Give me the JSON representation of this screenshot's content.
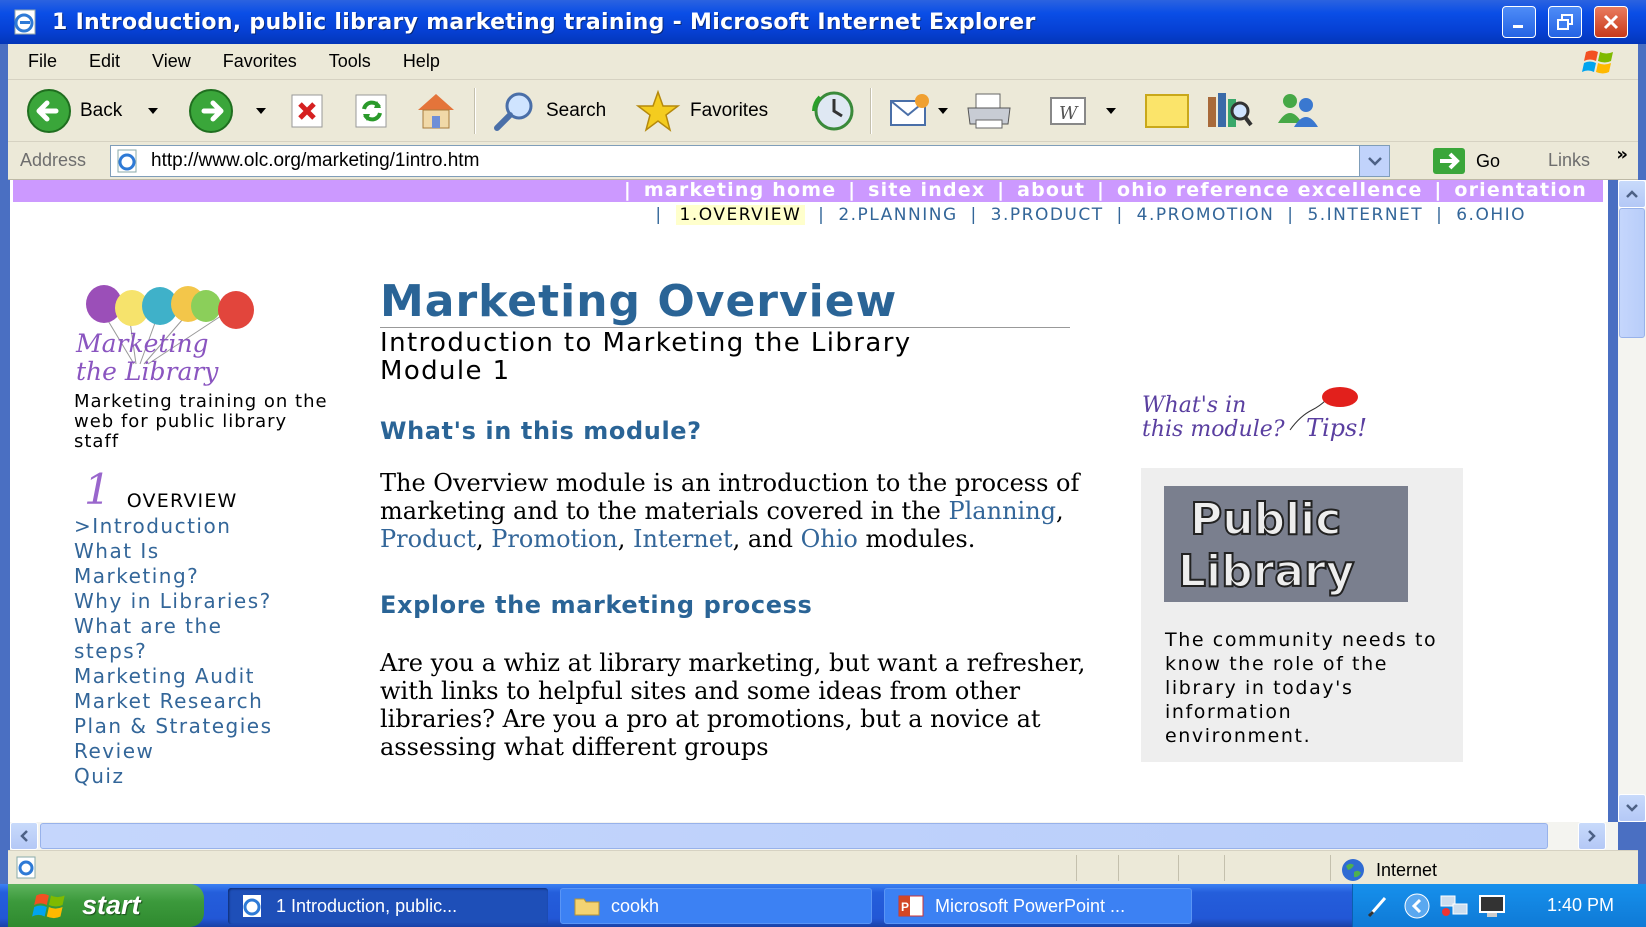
{
  "window": {
    "title": "1 Introduction, public library marketing training - Microsoft Internet Explorer"
  },
  "menubar": {
    "items": [
      "File",
      "Edit",
      "View",
      "Favorites",
      "Tools",
      "Help"
    ]
  },
  "toolbar": {
    "back_label": "Back",
    "search_label": "Search",
    "favorites_label": "Favorites"
  },
  "addressbar": {
    "label": "Address",
    "url": "http://www.olc.org/marketing/1intro.htm",
    "go_label": "Go",
    "links_label": "Links"
  },
  "site_nav": {
    "top_links": [
      "marketing home",
      "site index",
      "about",
      "ohio reference excellence",
      "orientation"
    ],
    "modules": [
      "1.OVERVIEW",
      "2.PLANNING",
      "3.PRODUCT",
      "4.PROMOTION",
      "5.INTERNET",
      "6.OHIO"
    ],
    "current_module": "1.OVERVIEW"
  },
  "left": {
    "logo_line1": "Marketing",
    "logo_line2": "the Library",
    "tagline": "Marketing training on the web for public library staff",
    "module_number": "1",
    "section": "OVERVIEW",
    "links": [
      "Introduction",
      "What Is Marketing?",
      "Why in Libraries?",
      "What are the steps?",
      "Marketing Audit",
      "Market Research",
      "Plan & Strategies",
      "Review",
      "Quiz"
    ],
    "current_link_prefix": ">"
  },
  "main": {
    "title": "Marketing Overview",
    "subtitle_line1": "Introduction to Marketing the Library",
    "subtitle_line2": "Module 1",
    "heading1": "What's in this module?",
    "para1_pre": "The Overview module is an introduction to the process of marketing and to the materials covered in the ",
    "para1_links": [
      "Planning",
      "Product",
      "Promotion",
      "Internet",
      "Ohio"
    ],
    "para1_sep": ", ",
    "para1_and": ", and ",
    "para1_post": " modules.",
    "heading2": "Explore the marketing process",
    "para2": "Are you a whiz at library marketing, but want a refresher, with links to helpful sites and some ideas from other libraries? Are you a pro at promotions, but a novice at assessing what different groups"
  },
  "right": {
    "tips_line1": "What's in",
    "tips_line2": "this module?",
    "tips_word": "Tips!",
    "image_text1": "Public",
    "image_text2": "Library",
    "box_text": "The community needs to know the role of the library in today's information environment."
  },
  "statusbar": {
    "zone": "Internet"
  },
  "taskbar": {
    "start_label": "start",
    "tasks": [
      "1 Introduction, public...",
      "cookh",
      "Microsoft PowerPoint ..."
    ],
    "clock": "1:40 PM"
  },
  "colors": {
    "nav_purple": "#cc99ff",
    "link_blue": "#336699",
    "heading_blue": "#2a6496",
    "xp_blue": "#0a4ee6"
  }
}
